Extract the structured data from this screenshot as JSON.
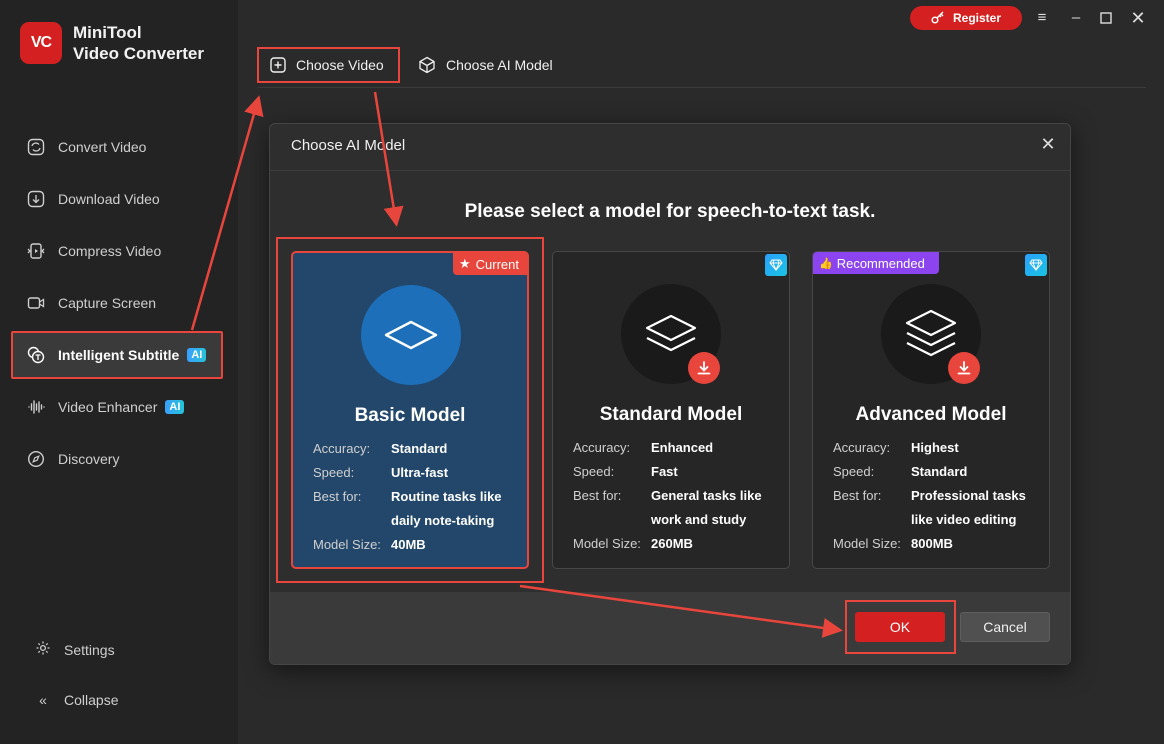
{
  "app": {
    "logo_mark": "VC",
    "name_line1": "MiniTool",
    "name_line2": "Video Converter"
  },
  "sidebar": {
    "items": [
      {
        "label": "Convert Video",
        "icon": "convert-icon"
      },
      {
        "label": "Download Video",
        "icon": "download-icon"
      },
      {
        "label": "Compress Video",
        "icon": "compress-icon"
      },
      {
        "label": "Capture Screen",
        "icon": "camera-icon"
      },
      {
        "label": "Intelligent Subtitle",
        "icon": "subtitle-icon",
        "badge": "AI",
        "active": true
      },
      {
        "label": "Video Enhancer",
        "icon": "waveform-icon",
        "badge": "AI"
      },
      {
        "label": "Discovery",
        "icon": "compass-icon"
      }
    ],
    "settings_label": "Settings",
    "collapse_label": "Collapse"
  },
  "topbar": {
    "register_label": "Register",
    "tabs": [
      {
        "label": "Choose Video",
        "icon": "plus-square-icon"
      },
      {
        "label": "Choose AI Model",
        "icon": "cube-icon"
      }
    ]
  },
  "dialog": {
    "title": "Choose AI Model",
    "heading": "Please select a model for speech-to-text task.",
    "ok_label": "OK",
    "cancel_label": "Cancel",
    "models": [
      {
        "name": "Basic Model",
        "badge": "Current",
        "specs": [
          {
            "k": "Accuracy:",
            "v": "Standard"
          },
          {
            "k": "Speed:",
            "v": "Ultra-fast"
          },
          {
            "k": "Best for:",
            "v": "Routine tasks like daily note-taking"
          },
          {
            "k": "Model Size:",
            "v": "40MB"
          }
        ]
      },
      {
        "name": "Standard Model",
        "specs": [
          {
            "k": "Accuracy:",
            "v": "Enhanced"
          },
          {
            "k": "Speed:",
            "v": "Fast"
          },
          {
            "k": "Best for:",
            "v": "General tasks like work and study"
          },
          {
            "k": "Model Size:",
            "v": "260MB"
          }
        ]
      },
      {
        "name": "Advanced Model",
        "badge": "Recommended",
        "specs": [
          {
            "k": "Accuracy:",
            "v": "Highest"
          },
          {
            "k": "Speed:",
            "v": "Standard"
          },
          {
            "k": "Best for:",
            "v": "Professional tasks like video editing"
          },
          {
            "k": "Model Size:",
            "v": "800MB"
          }
        ]
      }
    ]
  },
  "colors": {
    "accent_red": "#d42020",
    "annotation_red": "#e8453c",
    "selected_card": "#22476a",
    "ai_badge": "#3aa0ff",
    "recommended": "#8b44f0"
  }
}
